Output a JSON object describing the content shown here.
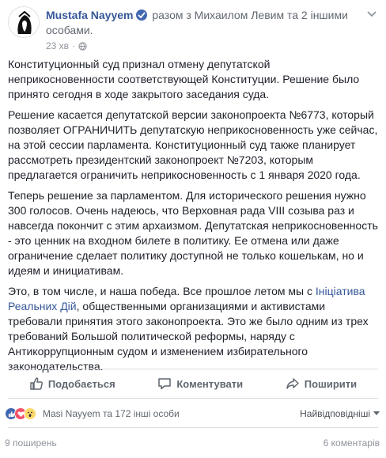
{
  "post": {
    "author": "Mustafa Nayyem",
    "with_text": "разом з Михаилом Левим та 2 іншими особами.",
    "time": "23 хв",
    "paragraphs": [
      "Конституционный суд признал отмену депутатской неприкосновенности соответствующей Конституции. Решение было принято сегодня в ходе закрытого заседания суда.",
      "Решение касается депутатской версии законопроекта №6773, который позволяет ОГРАНИЧИТЬ депутатскую неприкосновенность уже сейчас, на этой сессии парламента. Конституционный суд также планирует рассмотреть президентский законопроект №7203, которым предлагается ограничить неприкосновенность с 1 января 2020 года.",
      "Теперь решение за парламентом. Для исторического решения нужно 300 голосов. Очень надеюсь, что Верховная рада VIII созыва раз и навсегда покончит с этим архаизмом. Депутатская неприкосновенность - это ценник на входном билете в политику. Ее отмена или даже ограничение сделает политику доступной не только кошелькам, но и идеям и инициативам."
    ],
    "last_paragraph": {
      "before_link": "Это, в том числе, и наша победа. Все прошлое летом мы с ",
      "link": "Ініціатива Реальних Дій",
      "after_link": ", общественными организациями и активистами требовали принятия этого законопроекта. Это же было одним из трех требований Большой политической реформы, наряду с Антикоррупционным судом и изменением избирательного законодательства."
    }
  },
  "actions": {
    "like_label": "Подобається",
    "comment_label": "Коментувати",
    "share_label": "Поширити"
  },
  "reactions": {
    "text": "Masi Nayyem та 172 інші особи",
    "sort_label": "Найвідповідніші"
  },
  "footer": {
    "shares": "9 поширень",
    "comments": "6 коментарів"
  },
  "colors": {
    "link": "#365899",
    "like": "#4267b2",
    "love": "#f25268",
    "wow": "#fcd86a"
  }
}
